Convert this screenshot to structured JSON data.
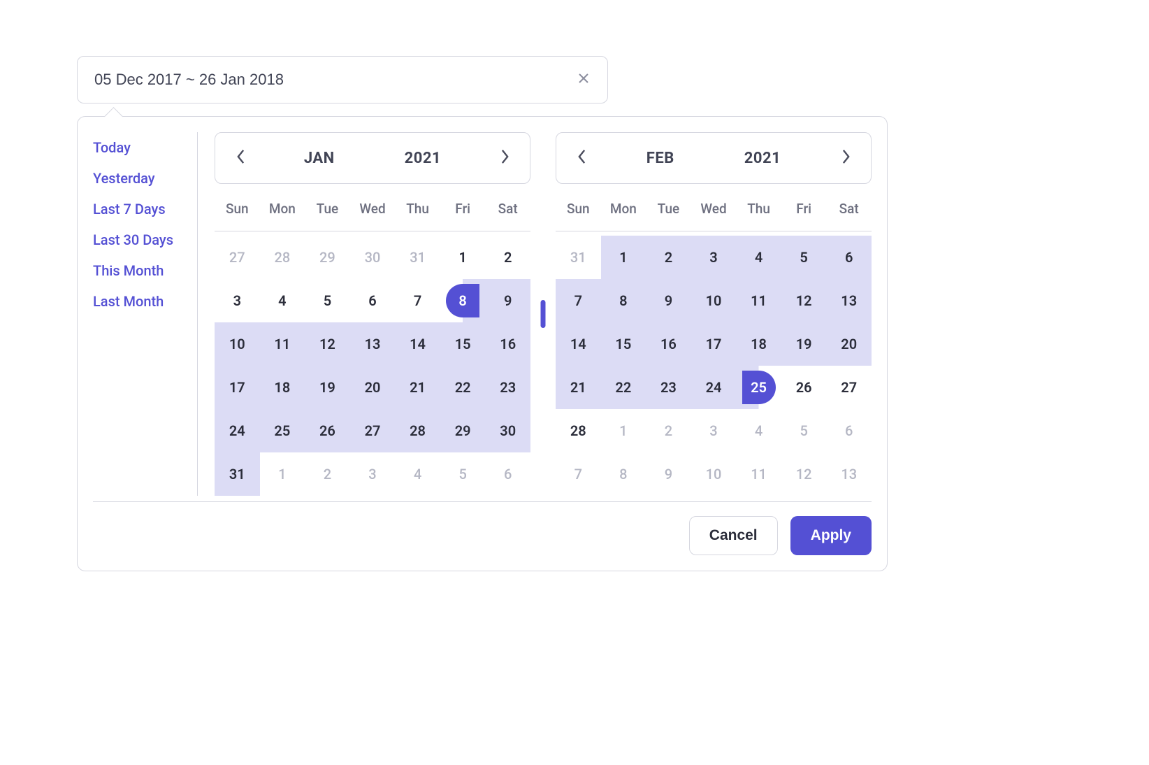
{
  "input": {
    "value": "05 Dec 2017 ~ 26 Jan 2018"
  },
  "presets": [
    "Today",
    "Yesterday",
    "Last 7 Days",
    "Last 30 Days",
    "This Month",
    "Last Month"
  ],
  "selection": {
    "start": "2021-01-08",
    "end": "2021-02-25"
  },
  "weekdays": [
    "Sun",
    "Mon",
    "Tue",
    "Wed",
    "Thu",
    "Fri",
    "Sat"
  ],
  "calendars": [
    {
      "month_label": "JAN",
      "year_label": "2021",
      "days": [
        {
          "n": 27,
          "other": true
        },
        {
          "n": 28,
          "other": true
        },
        {
          "n": 29,
          "other": true
        },
        {
          "n": 30,
          "other": true
        },
        {
          "n": 31,
          "other": true
        },
        {
          "n": 1
        },
        {
          "n": 2
        },
        {
          "n": 3
        },
        {
          "n": 4
        },
        {
          "n": 5
        },
        {
          "n": 6
        },
        {
          "n": 7
        },
        {
          "n": 8,
          "start": true,
          "in": true
        },
        {
          "n": 9,
          "in": true
        },
        {
          "n": 10,
          "in": true
        },
        {
          "n": 11,
          "in": true
        },
        {
          "n": 12,
          "in": true
        },
        {
          "n": 13,
          "in": true
        },
        {
          "n": 14,
          "in": true
        },
        {
          "n": 15,
          "in": true
        },
        {
          "n": 16,
          "in": true
        },
        {
          "n": 17,
          "in": true
        },
        {
          "n": 18,
          "in": true
        },
        {
          "n": 19,
          "in": true
        },
        {
          "n": 20,
          "in": true
        },
        {
          "n": 21,
          "in": true
        },
        {
          "n": 22,
          "in": true
        },
        {
          "n": 23,
          "in": true
        },
        {
          "n": 24,
          "in": true
        },
        {
          "n": 25,
          "in": true
        },
        {
          "n": 26,
          "in": true
        },
        {
          "n": 27,
          "in": true
        },
        {
          "n": 28,
          "in": true
        },
        {
          "n": 29,
          "in": true
        },
        {
          "n": 30,
          "in": true
        },
        {
          "n": 31,
          "in": true
        },
        {
          "n": 1,
          "other": true
        },
        {
          "n": 2,
          "other": true
        },
        {
          "n": 3,
          "other": true
        },
        {
          "n": 4,
          "other": true
        },
        {
          "n": 5,
          "other": true
        },
        {
          "n": 6,
          "other": true
        }
      ]
    },
    {
      "month_label": "FEB",
      "year_label": "2021",
      "days": [
        {
          "n": 31,
          "other": true
        },
        {
          "n": 1,
          "in": true
        },
        {
          "n": 2,
          "in": true
        },
        {
          "n": 3,
          "in": true
        },
        {
          "n": 4,
          "in": true
        },
        {
          "n": 5,
          "in": true
        },
        {
          "n": 6,
          "in": true
        },
        {
          "n": 7,
          "in": true
        },
        {
          "n": 8,
          "in": true
        },
        {
          "n": 9,
          "in": true
        },
        {
          "n": 10,
          "in": true
        },
        {
          "n": 11,
          "in": true
        },
        {
          "n": 12,
          "in": true
        },
        {
          "n": 13,
          "in": true
        },
        {
          "n": 14,
          "in": true
        },
        {
          "n": 15,
          "in": true
        },
        {
          "n": 16,
          "in": true
        },
        {
          "n": 17,
          "in": true
        },
        {
          "n": 18,
          "in": true
        },
        {
          "n": 19,
          "in": true
        },
        {
          "n": 20,
          "in": true
        },
        {
          "n": 21,
          "in": true
        },
        {
          "n": 22,
          "in": true
        },
        {
          "n": 23,
          "in": true
        },
        {
          "n": 24,
          "in": true
        },
        {
          "n": 25,
          "end": true,
          "in": true
        },
        {
          "n": 26
        },
        {
          "n": 27
        },
        {
          "n": 28
        },
        {
          "n": 1,
          "other": true
        },
        {
          "n": 2,
          "other": true
        },
        {
          "n": 3,
          "other": true
        },
        {
          "n": 4,
          "other": true
        },
        {
          "n": 5,
          "other": true
        },
        {
          "n": 6,
          "other": true
        },
        {
          "n": 7,
          "other": true
        },
        {
          "n": 8,
          "other": true
        },
        {
          "n": 9,
          "other": true
        },
        {
          "n": 10,
          "other": true
        },
        {
          "n": 11,
          "other": true
        },
        {
          "n": 12,
          "other": true
        },
        {
          "n": 13,
          "other": true
        }
      ]
    }
  ],
  "footer": {
    "cancel_label": "Cancel",
    "apply_label": "Apply"
  }
}
